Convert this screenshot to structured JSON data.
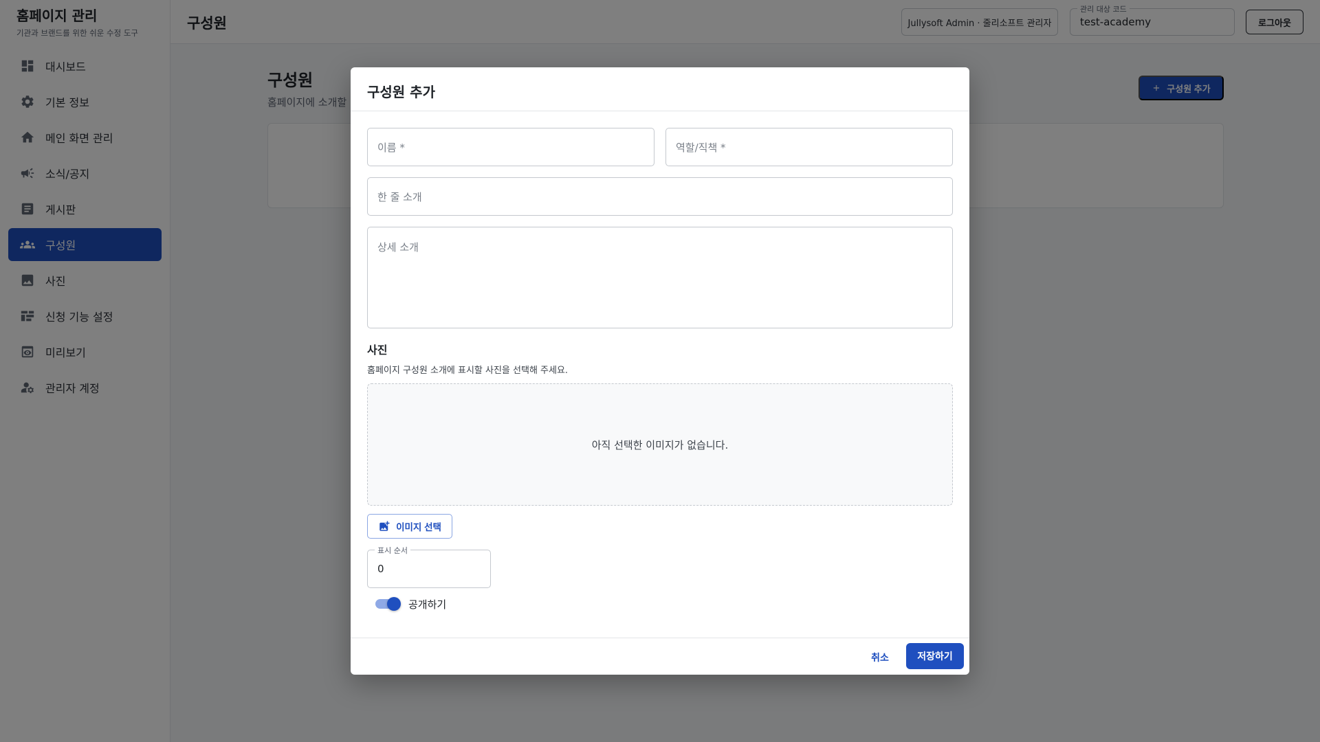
{
  "sidebar": {
    "title": "홈페이지 관리",
    "subtitle": "기관과 브랜드를 위한 쉬운 수정 도구",
    "items": [
      {
        "label": "대시보드",
        "icon": "dashboard-icon"
      },
      {
        "label": "기본 정보",
        "icon": "gear-icon"
      },
      {
        "label": "메인 화면 관리",
        "icon": "home-icon"
      },
      {
        "label": "소식/공지",
        "icon": "megaphone-icon"
      },
      {
        "label": "게시판",
        "icon": "article-icon"
      },
      {
        "label": "구성원",
        "icon": "people-icon",
        "active": true
      },
      {
        "label": "사진",
        "icon": "image-icon"
      },
      {
        "label": "신청 기능 설정",
        "icon": "form-icon"
      },
      {
        "label": "미리보기",
        "icon": "preview-icon"
      },
      {
        "label": "관리자 계정",
        "icon": "admin-account-icon"
      }
    ]
  },
  "header": {
    "title": "구성원",
    "admin_label": "Jullysoft Admin · 줄리소프트 관리자",
    "code_legend": "관리 대상 코드",
    "code_value": "test-academy",
    "logout": "로그아웃"
  },
  "page": {
    "title": "구성원",
    "subtitle": "홈페이지에 소개할",
    "add_button": "구성원 추가"
  },
  "modal": {
    "title": "구성원 추가",
    "name_placeholder": "이름 *",
    "role_placeholder": "역할/직책 *",
    "oneline_placeholder": "한 줄 소개",
    "detail_placeholder": "상세 소개",
    "photo_section_title": "사진",
    "photo_section_desc": "홈페이지 구성원 소개에 표시할 사진을 선택해 주세요.",
    "no_image": "아직 선택한 이미지가 없습니다.",
    "image_button": "이미지 선택",
    "order_legend": "표시 순서",
    "order_value": "0",
    "public_label": "공개하기",
    "public_on": true,
    "cancel": "취소",
    "save": "저장하기"
  },
  "colors": {
    "accent": "#1f4fbf"
  }
}
